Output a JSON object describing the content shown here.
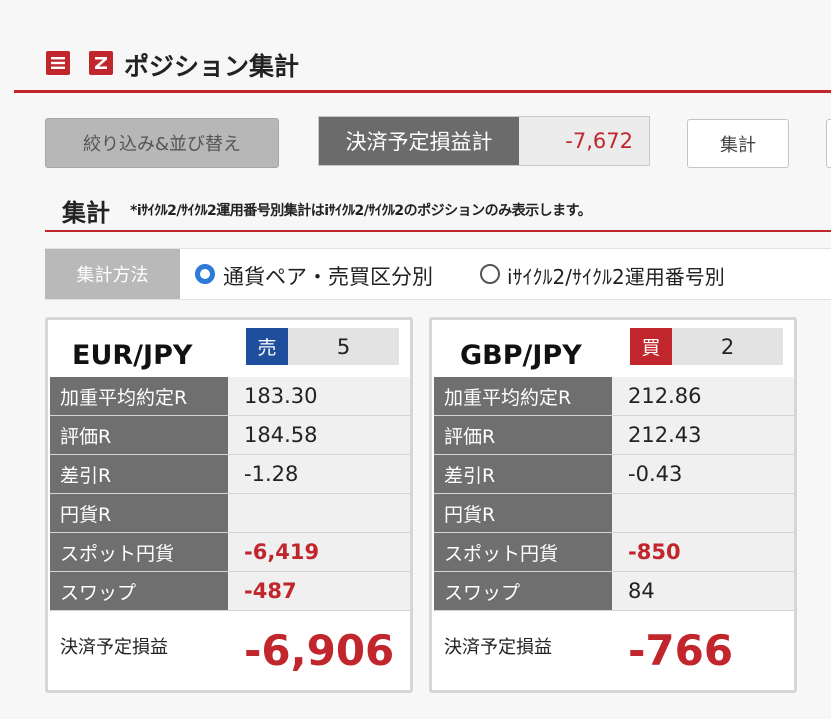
{
  "header": {
    "menu_icon": "menu-icon",
    "logo_icon": "z-logo-icon",
    "title": "ポジション集計"
  },
  "toolbar": {
    "filter_label": "絞り込み&並び替え",
    "pl_label": "決済予定損益計",
    "pl_value": "-7,672",
    "sum_label": "集計"
  },
  "section": {
    "title": "集計",
    "note": "*iｻｲｸﾙ2/ｻｲｸﾙ2運用番号別集計はiｻｲｸﾙ2/ｻｲｸﾙ2のポジションのみ表示します。"
  },
  "method": {
    "label": "集計方法",
    "options": [
      {
        "label": "通貨ペア・売買区分別",
        "selected": true
      },
      {
        "label": "iｻｲｸﾙ2/ｻｲｸﾙ2運用番号別",
        "selected": false
      }
    ]
  },
  "cards": [
    {
      "pair": "EUR/JPY",
      "side": "売",
      "side_color": "#1f4e9c",
      "qty": "5",
      "rows": [
        {
          "label": "加重平均約定R",
          "value": "183.30"
        },
        {
          "label": "評価R",
          "value": "184.58"
        },
        {
          "label": "差引R",
          "value": "-1.28"
        },
        {
          "label": "円貨R",
          "value": ""
        },
        {
          "label": "スポット円貨",
          "value": "-6,419"
        },
        {
          "label": "スワップ",
          "value": "-487"
        }
      ],
      "total_label": "決済予定損益",
      "total_value": "-6,906"
    },
    {
      "pair": "GBP/JPY",
      "side": "買",
      "side_color": "#c0262b",
      "qty": "2",
      "rows": [
        {
          "label": "加重平均約定R",
          "value": "212.86"
        },
        {
          "label": "評価R",
          "value": "212.43"
        },
        {
          "label": "差引R",
          "value": "-0.43"
        },
        {
          "label": "円貨R",
          "value": ""
        },
        {
          "label": "スポット円貨",
          "value": "-850"
        },
        {
          "label": "スワップ",
          "value": "84"
        }
      ],
      "total_label": "決済予定損益",
      "total_value": "-766"
    }
  ],
  "colors": {
    "accent": "#c0262b",
    "sell": "#1f4e9c",
    "radio": "#2e7ad9"
  }
}
